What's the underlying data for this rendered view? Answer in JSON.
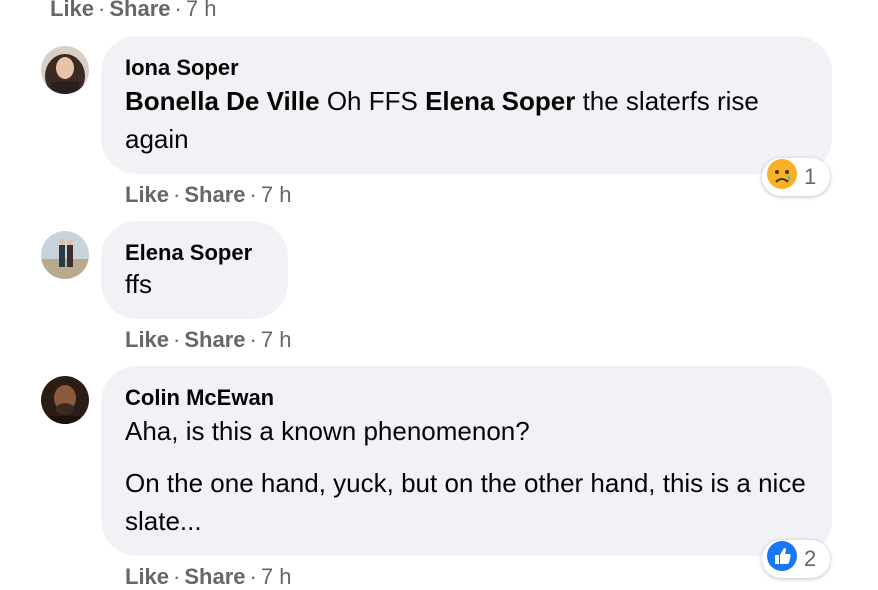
{
  "top_actions": {
    "like": "Like",
    "share": "Share",
    "time": "7 h"
  },
  "comments": [
    {
      "author": "Iona Soper",
      "mention1": "Bonella De Ville",
      "text1": " Oh FFS ",
      "mention2": "Elena Soper",
      "text2": " the slaterfs rise again",
      "reaction_count": "1",
      "reaction_icon": "sad-face-icon",
      "actions": {
        "like": "Like",
        "share": "Share",
        "time": "7 h"
      }
    },
    {
      "author": "Elena Soper",
      "text": "ffs",
      "actions": {
        "like": "Like",
        "share": "Share",
        "time": "7 h"
      }
    },
    {
      "author": "Colin McEwan",
      "para1": "Aha, is this a known phenomenon?",
      "para2": "On the one hand, yuck, but on the other hand, this is a nice slate...",
      "reaction_count": "2",
      "reaction_icon": "thumbs-up-icon",
      "actions": {
        "like": "Like",
        "share": "Share",
        "time": "7 h"
      }
    }
  ],
  "colors": {
    "bubble": "#f0f2f5",
    "meta": "#65676b",
    "like_blue": "#1877f2",
    "sad_yellow": "#f7b125"
  }
}
